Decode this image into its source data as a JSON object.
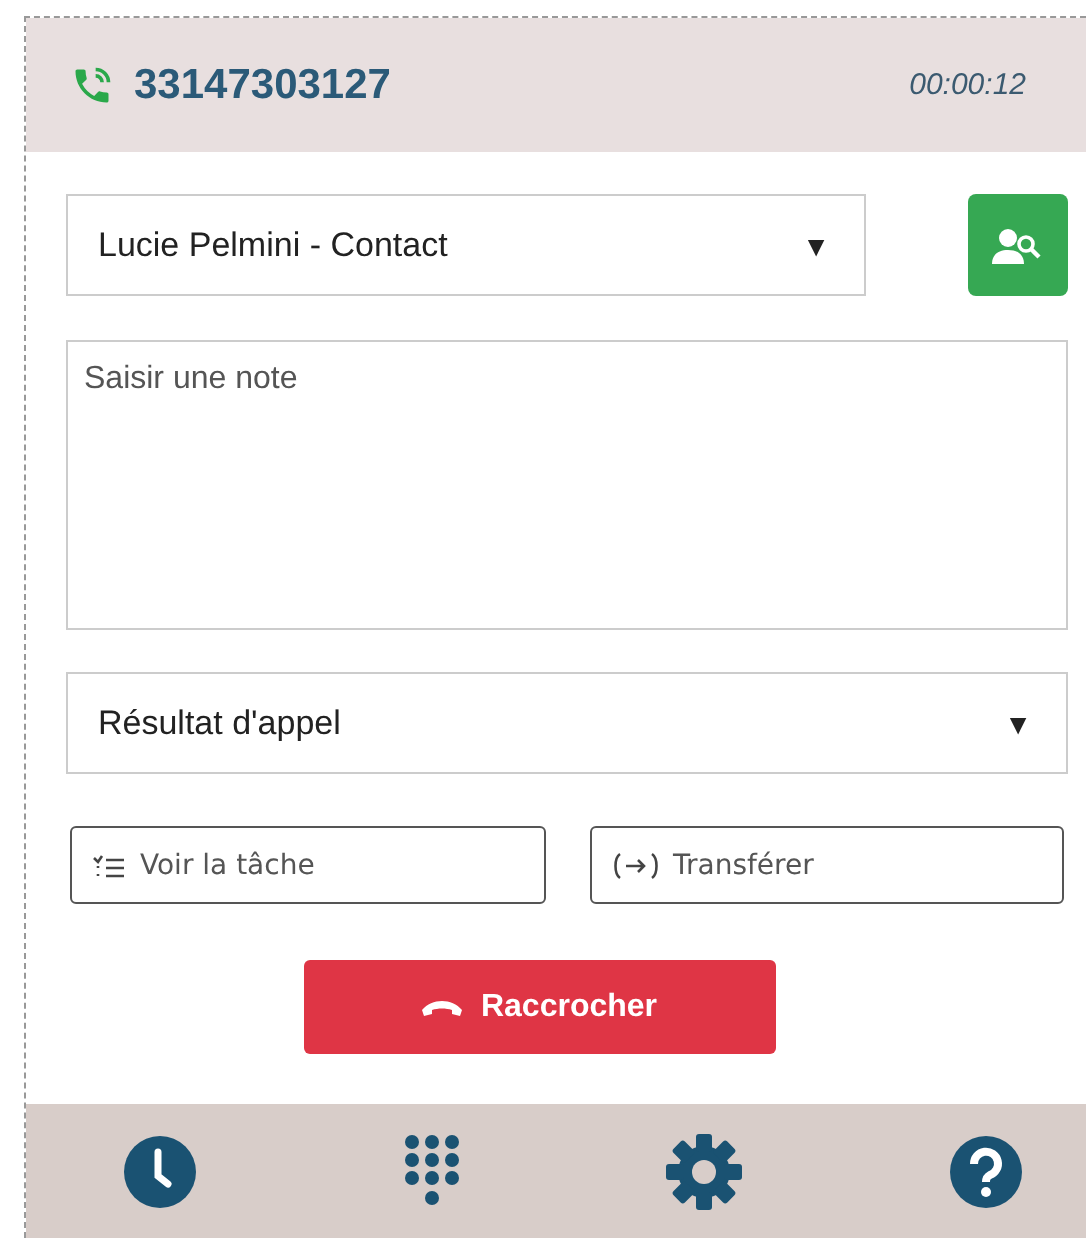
{
  "header": {
    "phone_number": "33147303127",
    "duration": "00:00:12"
  },
  "contact_select": {
    "value": "Lucie Pelmini - Contact",
    "caret": "▼"
  },
  "note": {
    "placeholder": "Saisir une note"
  },
  "result_select": {
    "value": "Résultat d'appel",
    "caret": "▼"
  },
  "actions": [
    {
      "kind": "task",
      "label": "Voir la tâche"
    },
    {
      "kind": "transfer",
      "label": "Transférer"
    }
  ],
  "hangup": {
    "label": "Raccrocher"
  },
  "footer": [
    {
      "kind": "history"
    },
    {
      "kind": "keypad"
    },
    {
      "kind": "settings"
    },
    {
      "kind": "help"
    }
  ]
}
